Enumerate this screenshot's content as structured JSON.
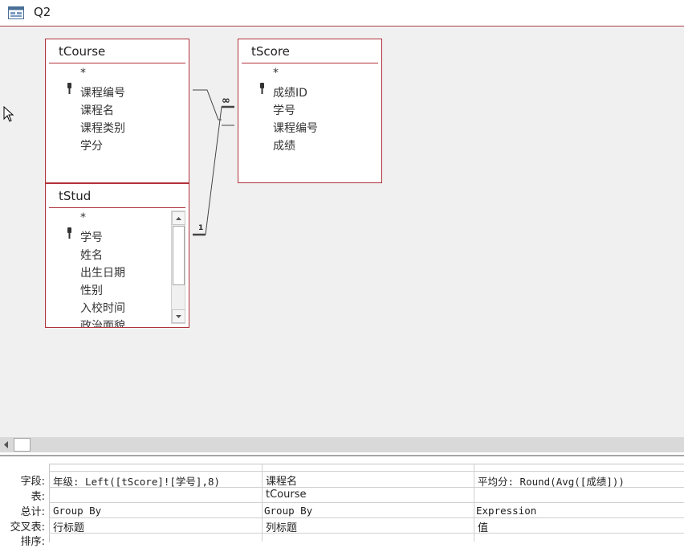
{
  "window": {
    "title": "Q2"
  },
  "tables": {
    "tCourse": {
      "name": "tCourse",
      "fields": [
        "*",
        "课程编号",
        "课程名",
        "课程类别",
        "学分"
      ]
    },
    "tScore": {
      "name": "tScore",
      "fields": [
        "*",
        "成绩ID",
        "学号",
        "课程编号",
        "成绩"
      ]
    },
    "tStud": {
      "name": "tStud",
      "fields": [
        "*",
        "学号",
        "姓名",
        "出生日期",
        "性别",
        "入校时间",
        "政治面貌"
      ]
    }
  },
  "relationships": {
    "one_label": "1",
    "many_label": "∞"
  },
  "grid": {
    "row_labels": [
      "字段:",
      "表:",
      "总计:",
      "交叉表:",
      "排序:"
    ],
    "columns": [
      {
        "field": "年级: Left([tScore]![学号],8)",
        "table": "",
        "total": "Group By",
        "crosstab": "行标题"
      },
      {
        "field": "课程名",
        "table": "tCourse",
        "total": "Group By",
        "crosstab": "列标题"
      },
      {
        "field": "平均分: Round(Avg([成绩]))",
        "table": "",
        "total": "Expression",
        "crosstab": "值"
      }
    ]
  },
  "icons": {
    "query": "query-design-icon",
    "key": "primary-key-icon",
    "cursor": "mouse-pointer-icon",
    "scroll_up": "scroll-up-arrow-icon",
    "scroll_down": "scroll-down-arrow-icon",
    "scroll_left": "scroll-left-arrow-icon"
  },
  "colors": {
    "accent": "#b0313a",
    "canvas": "#f0f0f0"
  }
}
